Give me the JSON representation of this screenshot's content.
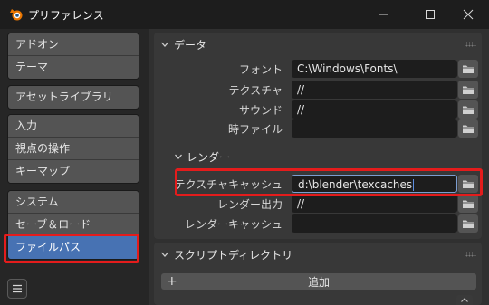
{
  "window": {
    "title": "プリファレンス",
    "minimize_icon": "minimize-icon",
    "maximize_icon": "maximize-icon",
    "close_icon": "close-icon"
  },
  "sidebar": {
    "groups": [
      {
        "items": [
          {
            "label": "アドオン"
          },
          {
            "label": "テーマ"
          }
        ]
      },
      {
        "items": [
          {
            "label": "アセットライブラリ"
          }
        ]
      },
      {
        "items": [
          {
            "label": "入力"
          },
          {
            "label": "視点の操作"
          },
          {
            "label": "キーマップ"
          }
        ]
      },
      {
        "items": [
          {
            "label": "システム"
          },
          {
            "label": "セーブ＆ロード"
          },
          {
            "label": "ファイルパス"
          }
        ]
      }
    ],
    "active_item": "ファイルパス"
  },
  "data_panel": {
    "title": "データ",
    "rows": [
      {
        "label": "フォント",
        "value": "C:\\Windows\\Fonts\\"
      },
      {
        "label": "テクスチャ",
        "value": "//"
      },
      {
        "label": "サウンド",
        "value": "//"
      },
      {
        "label": "一時ファイル",
        "value": ""
      }
    ],
    "render": {
      "title": "レンダー",
      "rows": [
        {
          "label": "テクスチャキャッシュ",
          "value": "d:\\blender\\texcaches"
        },
        {
          "label": "レンダー出力",
          "value": "//"
        },
        {
          "label": "レンダーキャッシュ",
          "value": ""
        }
      ]
    }
  },
  "scripts_panel": {
    "title": "スクリプトディレクトリ",
    "add_label": "追加",
    "add_symbol": "+"
  },
  "colors": {
    "active": "#4772b3",
    "highlight": "#e41c1c"
  }
}
